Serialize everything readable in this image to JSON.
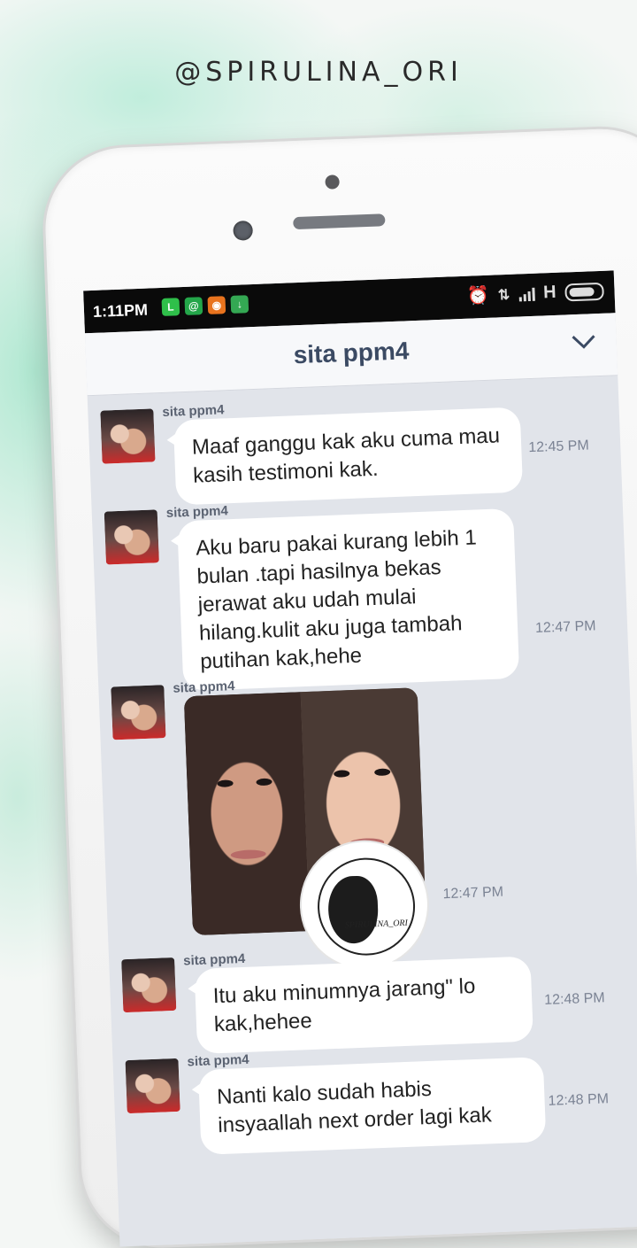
{
  "brand": "@SPIRULINA_ORI",
  "status": {
    "time": "1:11PM",
    "network": "H"
  },
  "header": {
    "title": "sita ppm4"
  },
  "messages": [
    {
      "sender": "sita ppm4",
      "text": "Maaf ganggu kak aku cuma mau kasih testimoni kak.",
      "time": "12:45 PM"
    },
    {
      "sender": "sita ppm4",
      "text": "Aku baru pakai kurang lebih 1 bulan .tapi hasilnya bekas jerawat aku udah mulai hilang.kulit aku juga tambah putihan kak,hehe",
      "time": "12:47 PM"
    },
    {
      "sender": "sita ppm4",
      "text": "",
      "time": "12:47 PM",
      "type": "photo"
    },
    {
      "sender": "sita ppm4",
      "text": "Itu aku minumnya jarang\" lo kak,hehee",
      "time": "12:48 PM"
    },
    {
      "sender": "sita ppm4",
      "text": "Nanti kalo sudah habis insyaallah next order lagi kak",
      "time": "12:48 PM"
    }
  ],
  "watermark": {
    "text": "SPIRULINA_ORI"
  },
  "icons": [
    "line-icon",
    "email-icon",
    "app-icon",
    "download-icon",
    "alarm-icon",
    "data-icon",
    "signal-icon",
    "battery-icon",
    "chevron-down-icon"
  ]
}
